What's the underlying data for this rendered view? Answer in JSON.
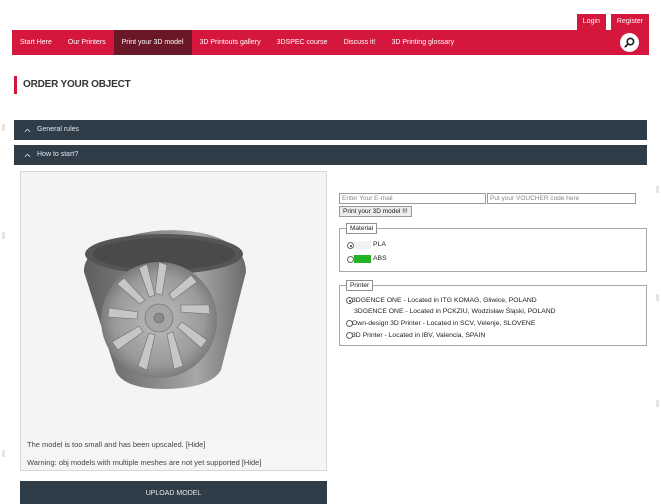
{
  "auth": {
    "login": "Login",
    "register": "Register"
  },
  "nav": {
    "items": [
      "Start Here",
      "Our Printers",
      "Print your 3D model",
      "3D Printouts gallery",
      "3DSPEC course",
      "Discuss it!",
      "3D Printing glossary"
    ],
    "active_index": 2,
    "search_icon": "search-icon"
  },
  "page": {
    "title": "ORDER YOUR OBJECT"
  },
  "accordion": [
    {
      "label": "General rules",
      "icon": "chevron-up-icon"
    },
    {
      "label": "How to start?",
      "icon": "chevron-up-icon"
    }
  ],
  "viewer": {
    "messages": [
      "The model is too small and has been upscaled. [Hide]",
      "Warning: obj models with multiple meshes are not yet supported [Hide]"
    ],
    "upload_label": "UPLOAD MODEL"
  },
  "form": {
    "email_placeholder": "Enter Your E-mail",
    "voucher_placeholder": "Put your VOUCHER code here",
    "print_button": "Print your 3D model !!!"
  },
  "material": {
    "legend": "Material",
    "options": [
      {
        "label": "PLA",
        "color": "#f2f2f2",
        "checked": true
      },
      {
        "label": "ABS",
        "color": "#22b222",
        "checked": false
      }
    ]
  },
  "printer": {
    "legend": "Printer",
    "options": [
      {
        "label": "3DGENCE ONE - Located in ITG KOMAG, Gliwice, POLAND",
        "checked": true
      },
      {
        "label": "3DGENCE ONE - Located in PCKZIU, Wodzisław Śląski, POLAND",
        "checked": false
      },
      {
        "label": "Own-design 3D Printer - Located in SCV, Velenje, SLOVENE",
        "checked": false
      },
      {
        "label": "3D Printer - Located in IBV, Valencia, SPAIN",
        "checked": false
      }
    ]
  },
  "colors": {
    "accent": "#d5163d",
    "nav_active": "#6a1727",
    "accordion": "#2f3d48"
  }
}
